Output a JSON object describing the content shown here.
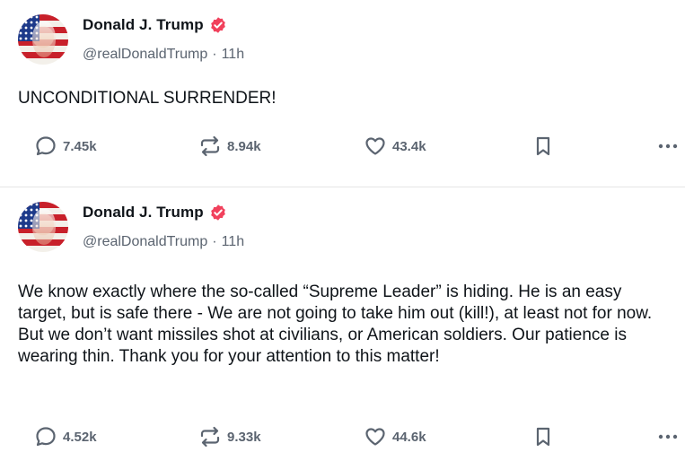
{
  "posts": [
    {
      "author": {
        "name": "Donald J. Trump",
        "handle": "@realDonaldTrump",
        "time": "11h"
      },
      "text": "UNCONDITIONAL SURRENDER!",
      "stats": {
        "replies": "7.45k",
        "retruths": "8.94k",
        "likes": "43.4k"
      }
    },
    {
      "author": {
        "name": "Donald J. Trump",
        "handle": "@realDonaldTrump",
        "time": "11h"
      },
      "text": "We know exactly where the so-called “Supreme Leader” is hiding. He is an easy target, but is safe there - We are not going to take him out (kill!), at least not for now. But we don’t want missiles shot at civilians, or American soldiers. Our patience is wearing thin. Thank you for your attention to this matter!",
      "stats": {
        "replies": "4.52k",
        "retruths": "9.33k",
        "likes": "44.6k"
      }
    }
  ],
  "icons": {
    "reply": "speech-bubble-icon",
    "retruth": "repost-arrows-icon",
    "like": "heart-icon",
    "bookmark": "bookmark-icon",
    "more": "more-dots-icon",
    "verified": "verified-badge-icon"
  },
  "colors": {
    "verified": "#f1415c",
    "icon": "#5b6470",
    "text": "#0f1419",
    "divider": "#e6e6e6"
  }
}
